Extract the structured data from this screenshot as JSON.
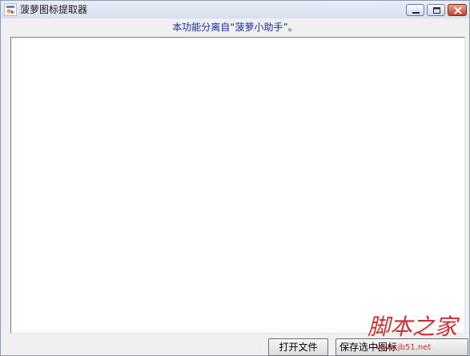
{
  "window": {
    "title": "菠萝图标提取器",
    "icon": "app-icon",
    "controls": [
      "minimize-icon",
      "maximize-icon",
      "close-icon"
    ]
  },
  "header": {
    "notice": "本功能分离自“菠萝小助手”。"
  },
  "buttons": {
    "open_file": "打开文件",
    "save_selected": "保存选中图标"
  },
  "colors": {
    "notice_text": "#1a2aa8",
    "titlebar": "#dce5f2",
    "watermark": "#c81e1e"
  },
  "watermark": {
    "site_name": "脚本之家",
    "site_url": "www.jb51.net"
  }
}
